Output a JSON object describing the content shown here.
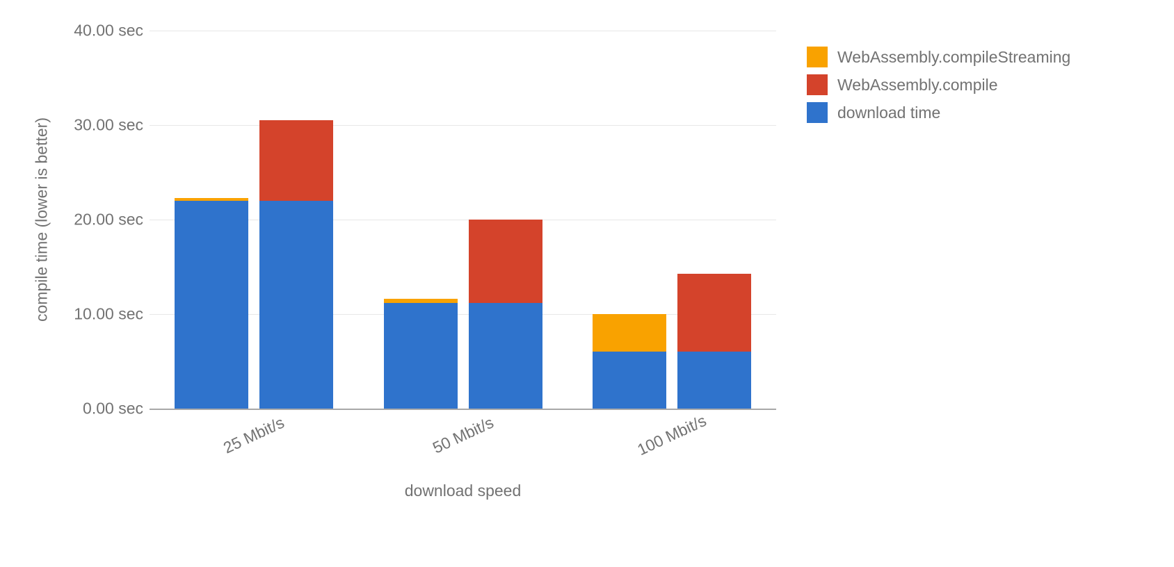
{
  "chart_data": {
    "type": "bar",
    "xlabel": "download speed",
    "ylabel": "compile time (lower is better)",
    "ylim": [
      0,
      40
    ],
    "ytick_labels": [
      "0.00 sec",
      "10.00 sec",
      "20.00 sec",
      "30.00 sec",
      "40.00 sec"
    ],
    "ytick_values": [
      0,
      10,
      20,
      30,
      40
    ],
    "categories": [
      "25 Mbit/s",
      "50 Mbit/s",
      "100 Mbit/s"
    ],
    "legend": [
      {
        "name": "WebAssembly.compileStreaming",
        "color": "#f9a200"
      },
      {
        "name": "WebAssembly.compile",
        "color": "#d4432b"
      },
      {
        "name": "download time",
        "color": "#2f73cc"
      }
    ],
    "series": [
      {
        "name": "compileStreaming",
        "stack": [
          {
            "layer": "download time",
            "value": 22.0
          },
          {
            "layer": "WebAssembly.compileStreaming",
            "value": 0.3
          }
        ]
      },
      {
        "name": "compile",
        "stack": [
          {
            "layer": "download time",
            "value": 22.0
          },
          {
            "layer": "WebAssembly.compile",
            "value": 8.5
          }
        ]
      },
      {
        "name": "compileStreaming",
        "stack": [
          {
            "layer": "download time",
            "value": 11.2
          },
          {
            "layer": "WebAssembly.compileStreaming",
            "value": 0.4
          }
        ]
      },
      {
        "name": "compile",
        "stack": [
          {
            "layer": "download time",
            "value": 11.2
          },
          {
            "layer": "WebAssembly.compile",
            "value": 8.8
          }
        ]
      },
      {
        "name": "compileStreaming",
        "stack": [
          {
            "layer": "download time",
            "value": 6.0
          },
          {
            "layer": "WebAssembly.compileStreaming",
            "value": 4.0
          }
        ]
      },
      {
        "name": "compile",
        "stack": [
          {
            "layer": "download time",
            "value": 6.0
          },
          {
            "layer": "WebAssembly.compile",
            "value": 8.3
          }
        ]
      }
    ],
    "groups": [
      {
        "category": "25 Mbit/s",
        "bars": [
          0,
          1
        ]
      },
      {
        "category": "50 Mbit/s",
        "bars": [
          2,
          3
        ]
      },
      {
        "category": "100 Mbit/s",
        "bars": [
          4,
          5
        ]
      }
    ]
  }
}
